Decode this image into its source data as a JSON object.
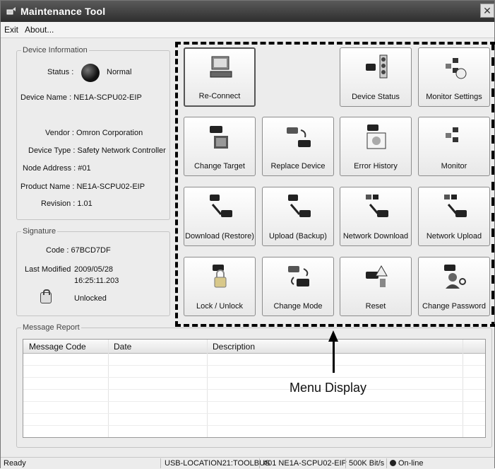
{
  "window": {
    "title": "Maintenance Tool",
    "close_glyph": "✕"
  },
  "menu": {
    "exit": "Exit",
    "about": "About..."
  },
  "device_info": {
    "legend": "Device Information",
    "status_label": "Status :",
    "status_value": "Normal",
    "device_name": "Device Name : NE1A-SCPU02-EIP",
    "vendor": "Vendor : Omron Corporation",
    "device_type": "Device Type : Safety Network Controller",
    "node_address": "Node Address : #01",
    "product_name": "Product Name : NE1A-SCPU02-EIP",
    "revision": "Revision : 1.01"
  },
  "signature": {
    "legend": "Signature",
    "code": "Code : 67BCD7DF",
    "last_modified_label": "Last Modified",
    "last_modified_date": "2009/05/28",
    "last_modified_time": "16:25:11.203",
    "lock_state": "Unlocked"
  },
  "buttons": {
    "reconnect": "Re-Connect",
    "device_status": "Device Status",
    "monitor_settings": "Monitor Settings",
    "change_target": "Change Target",
    "replace_device": "Replace Device",
    "error_history": "Error History",
    "monitor": "Monitor",
    "download": "Download (Restore)",
    "upload": "Upload (Backup)",
    "network_download": "Network Download",
    "network_upload": "Network Upload",
    "lock_unlock": "Lock / Unlock",
    "change_mode": "Change Mode",
    "reset": "Reset",
    "change_password": "Change Password"
  },
  "message_report": {
    "legend": "Message Report",
    "columns": [
      "Message Code",
      "Date",
      "Description"
    ]
  },
  "annotation": {
    "text": "Menu Display"
  },
  "statusbar": {
    "ready": "Ready",
    "connection": "USB-LOCATION21:TOOLBUS",
    "node": "#01 NE1A-SCPU02-EIP",
    "baud": "500K Bit/s",
    "online": "On-line"
  },
  "colors": {
    "titlebar": "#3c3c3c",
    "window_bg": "#ececec"
  }
}
